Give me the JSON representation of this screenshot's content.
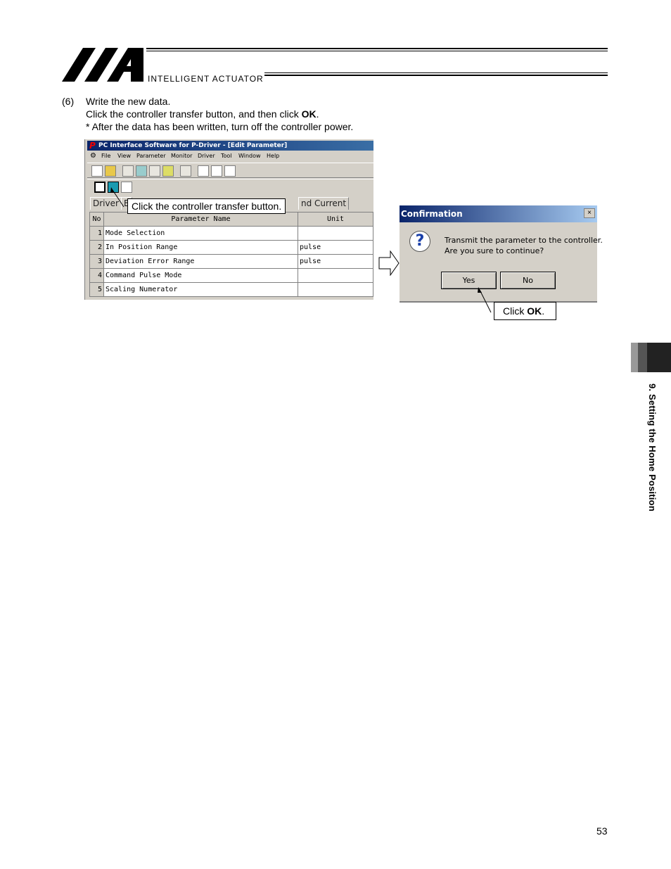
{
  "header": {
    "brand": "INTELLIGENT ACTUATOR"
  },
  "step": {
    "number": "(6)",
    "title": "Write the new data.",
    "line2_prefix": "Click the controller transfer button, and then click ",
    "line2_bold": "OK",
    "line2_suffix": ".",
    "line3": "* After the data has been written, turn off the controller power."
  },
  "app_window": {
    "title": "PC Interface Software for P-Driver - [Edit Parameter]",
    "logo_letter": "P",
    "menu": [
      "File",
      "View",
      "Parameter",
      "Monitor",
      "Driver",
      "Tool",
      "Window",
      "Help"
    ],
    "tabs": [
      "Driver",
      "E",
      "nd Current"
    ],
    "table": {
      "headers": [
        "No",
        "Parameter Name",
        "Unit"
      ],
      "rows": [
        {
          "no": "1",
          "name": "Mode Selection",
          "unit": ""
        },
        {
          "no": "2",
          "name": "In Position Range",
          "unit": "pulse"
        },
        {
          "no": "3",
          "name": "Deviation Error Range",
          "unit": "pulse"
        },
        {
          "no": "4",
          "name": "Command Pulse Mode",
          "unit": ""
        },
        {
          "no": "5",
          "name": "Scaling Numerator",
          "unit": ""
        }
      ]
    }
  },
  "callout_transfer": "Click the controller transfer button.",
  "dialog": {
    "title": "Confirmation",
    "close": "×",
    "icon": "?",
    "message_line1": "Transmit the parameter to the controller.",
    "message_line2": "Are you sure to continue?",
    "yes_label": "Yes",
    "no_label": "No"
  },
  "callout_ok": {
    "prefix": "Click ",
    "bold": "OK",
    "suffix": "."
  },
  "side_tab": "9. Setting the Home Position",
  "page_number": "53",
  "colors": {
    "title_bar": "#0a246a",
    "transfer_button": "#1a9bb0"
  }
}
